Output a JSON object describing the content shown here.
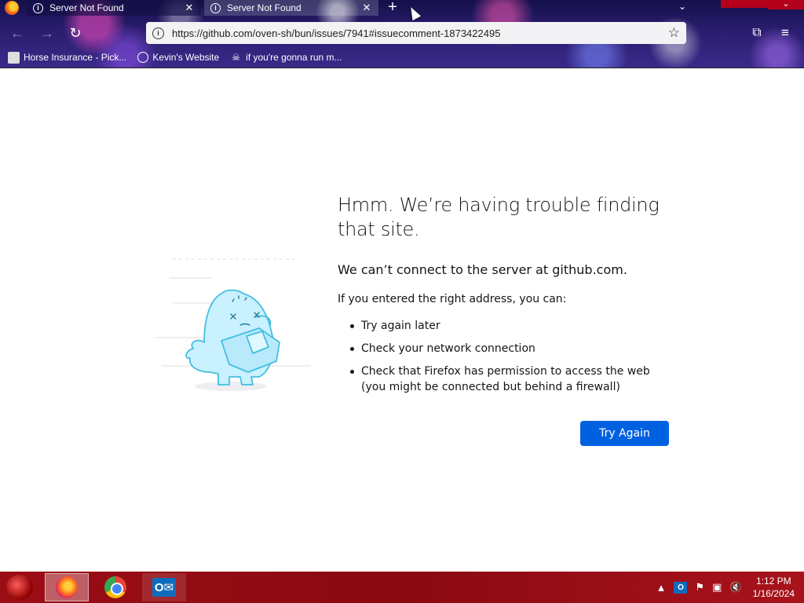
{
  "browser": {
    "tabs": [
      {
        "title": "Server Not Found",
        "active": false
      },
      {
        "title": "Server Not Found",
        "active": true
      }
    ],
    "new_tab_label": "+",
    "url": "https://github.com/oven-sh/bun/issues/7941#issuecomment-1873422495",
    "bookmarks": [
      {
        "label": "Horse Insurance - Pick...",
        "icon": "horse-favicon"
      },
      {
        "label": "Kevin's Website",
        "icon": "globe-icon"
      },
      {
        "label": "if you're gonna run m...",
        "icon": "skull-favicon"
      }
    ]
  },
  "error_page": {
    "title": "Hmm. We’re having trouble finding that site.",
    "description": "We can’t connect to the server at github.com.",
    "hint": "If you entered the right address, you can:",
    "suggestions": [
      "Try again later",
      "Check your network connection",
      "Check that Firefox has permission to access the web (you might be connected but behind a firewall)"
    ],
    "button_label": "Try Again",
    "button_color": "#0061e0"
  },
  "taskbar": {
    "apps": [
      "Firefox",
      "Chrome",
      "Outlook"
    ],
    "clock_time": "1:12 PM",
    "clock_date": "1/16/2024",
    "accent": "#9b0d14"
  }
}
